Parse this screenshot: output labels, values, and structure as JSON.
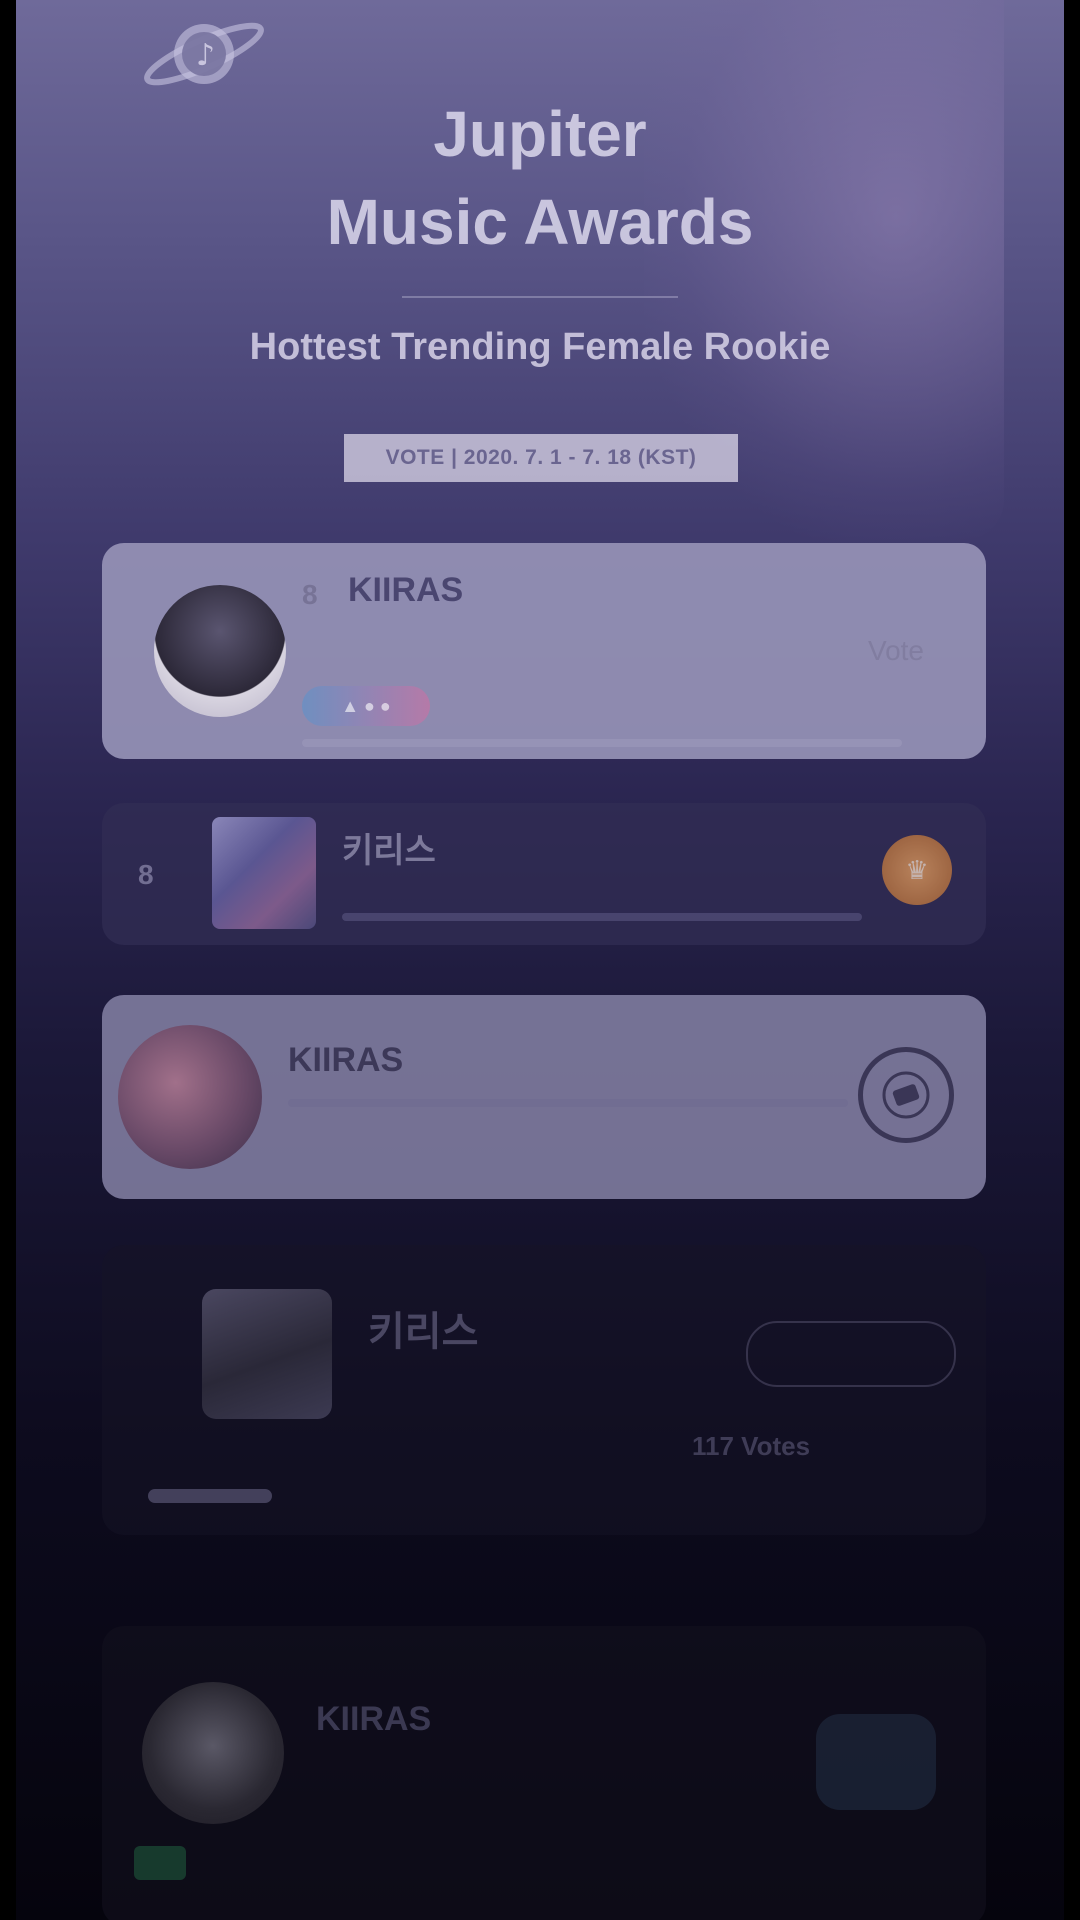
{
  "header": {
    "title_line1": "Jupiter",
    "title_line2": "Music Awards",
    "subtitle": "Hottest Trending Female Rookie",
    "vote_period": "VOTE | 2020. 7. 1 - 7. 18 (KST)"
  },
  "cards": [
    {
      "rank": "8",
      "name": "KIIRAS",
      "action_label": "Vote"
    },
    {
      "rank": "8",
      "name": "키리스"
    },
    {
      "name": "KIIRAS"
    },
    {
      "name": "키리스",
      "votes_label": "117 Votes"
    },
    {
      "name": "KIIRAS"
    }
  ],
  "colors": {
    "background_top": "#6f6a9a",
    "background_bottom": "#05040d",
    "accent_orange": "#e6a060",
    "pill_gradient": [
      "#6f8fc0",
      "#b57aa8"
    ]
  },
  "icons": {
    "logo": "music-note-planet-icon",
    "card2_badge": "trophy-badge-icon",
    "card3_action": "ticket-vote-icon"
  }
}
